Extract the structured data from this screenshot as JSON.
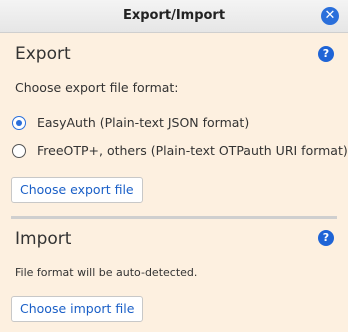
{
  "window": {
    "title": "Export/Import",
    "close_label": "✕"
  },
  "export": {
    "title": "Export",
    "help_label": "?",
    "prompt": "Choose export file format:",
    "options": [
      {
        "label": "EasyAuth (Plain-text JSON format)",
        "selected": true
      },
      {
        "label": "FreeOTP+, others (Plain-text OTPauth URI format)",
        "selected": false
      }
    ],
    "button_label": "Choose export file"
  },
  "import": {
    "title": "Import",
    "help_label": "?",
    "note": "File format will be auto-detected.",
    "button_label": "Choose import file"
  },
  "colors": {
    "accent": "#2a6fdb",
    "background": "#fdf0e0",
    "link": "#1a5fc7"
  }
}
